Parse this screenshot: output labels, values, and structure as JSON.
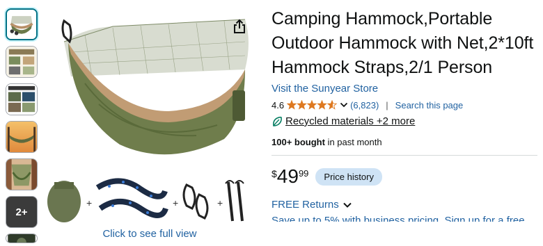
{
  "gallery": {
    "thumbnails": [
      {
        "name": "thumb-hammock-main",
        "selected": true
      },
      {
        "name": "thumb-infographic"
      },
      {
        "name": "thumb-feature-grid"
      },
      {
        "name": "thumb-hammock-sunset"
      },
      {
        "name": "thumb-hammock-forest"
      }
    ],
    "more_label": "2+",
    "full_view_label": "Click to see full view",
    "share_icon": "share-icon"
  },
  "product": {
    "title": "Camping Hammock,Portable Outdoor Hammock with Net,2*10ft Hammock Straps,2/1 Person",
    "store_link": "Visit the Sunyear Store",
    "rating": "4.6",
    "rating_value": 4.6,
    "review_count": "(6,823)",
    "rating_separator": "|",
    "search_page_label": "Search this page",
    "climate_label": "Recycled materials +2 more",
    "bought_bold": "100+ bought",
    "bought_rest": " in past month",
    "price_symbol": "$",
    "price_whole": "49",
    "price_fraction": "99",
    "price_history_label": "Price history",
    "returns_label": "FREE Returns",
    "business_label": "Save up to 5% with business pricing. Sign up for a free"
  },
  "colors": {
    "link": "#2162a1",
    "star": "#de7921",
    "price_history_bg": "#cfe3f5",
    "selected_thumb_border": "#007185"
  }
}
